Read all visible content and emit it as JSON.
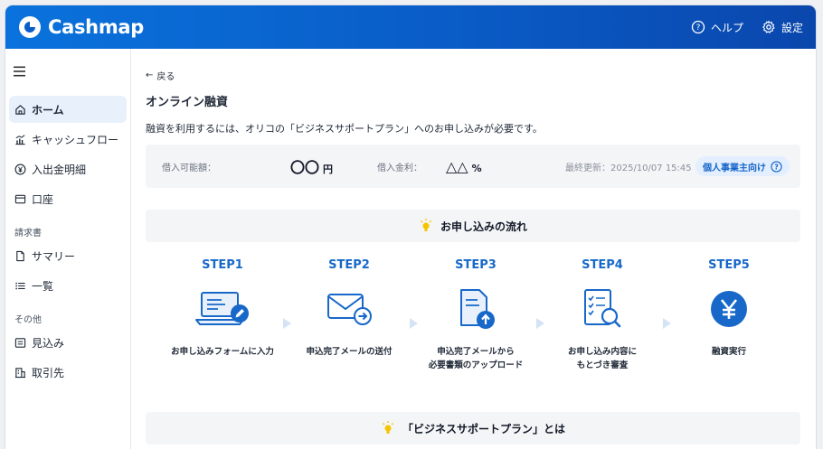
{
  "app": {
    "brand": "Cashmap"
  },
  "header": {
    "help_label": "ヘルプ",
    "settings_label": "設定"
  },
  "sidebar": {
    "items_top": [
      {
        "label": "ホーム"
      },
      {
        "label": "キャッシュフロー"
      },
      {
        "label": "入出金明細"
      },
      {
        "label": "口座"
      }
    ],
    "section_invoice": "請求書",
    "items_invoice": [
      {
        "label": "サマリー"
      },
      {
        "label": "一覧"
      }
    ],
    "section_other": "その他",
    "items_other": [
      {
        "label": "見込み"
      },
      {
        "label": "取引先"
      }
    ]
  },
  "main": {
    "back_label": "戻る",
    "title": "オンライン融資",
    "description": "融資を利用するには、オリコの「ビジネスサポートプラン」へのお申し込みが必要です。",
    "info": {
      "limit_label": "借入可能額：",
      "limit_value": "〇〇",
      "limit_unit": "円",
      "rate_label": "借入金利：",
      "rate_value": "△△",
      "rate_unit": "%",
      "updated": "最終更新：2025/10/07 15:45",
      "badge": "個人事業主向け"
    },
    "flow_title": "お申し込みの流れ",
    "steps": [
      {
        "title": "STEP1",
        "text": "お申し込みフォームに入力",
        "text2": ""
      },
      {
        "title": "STEP2",
        "text": "申込完了メールの送付",
        "text2": ""
      },
      {
        "title": "STEP3",
        "text": "申込完了メールから",
        "text2": "必要書類のアップロード"
      },
      {
        "title": "STEP4",
        "text": "お申し込み内容に",
        "text2": "もとづき審査"
      },
      {
        "title": "STEP5",
        "text": "融資実行",
        "text2": ""
      }
    ],
    "plan_title": "「ビジネスサポートプラン」とは"
  },
  "colors": {
    "brand": "#0a5cc7",
    "accent": "#1768c9",
    "active_bg": "#e8f1fb"
  },
  "icons": [
    "cashmap-logo-icon",
    "help-icon",
    "gear-icon",
    "menu-icon",
    "home-icon",
    "chart-icon",
    "yen-circle-icon",
    "card-icon",
    "document-icon",
    "list-icon",
    "forecast-icon",
    "building-icon",
    "bulb-icon",
    "laptop-edit-icon",
    "mail-send-icon",
    "document-upload-icon",
    "checklist-search-icon",
    "yen-icon"
  ]
}
